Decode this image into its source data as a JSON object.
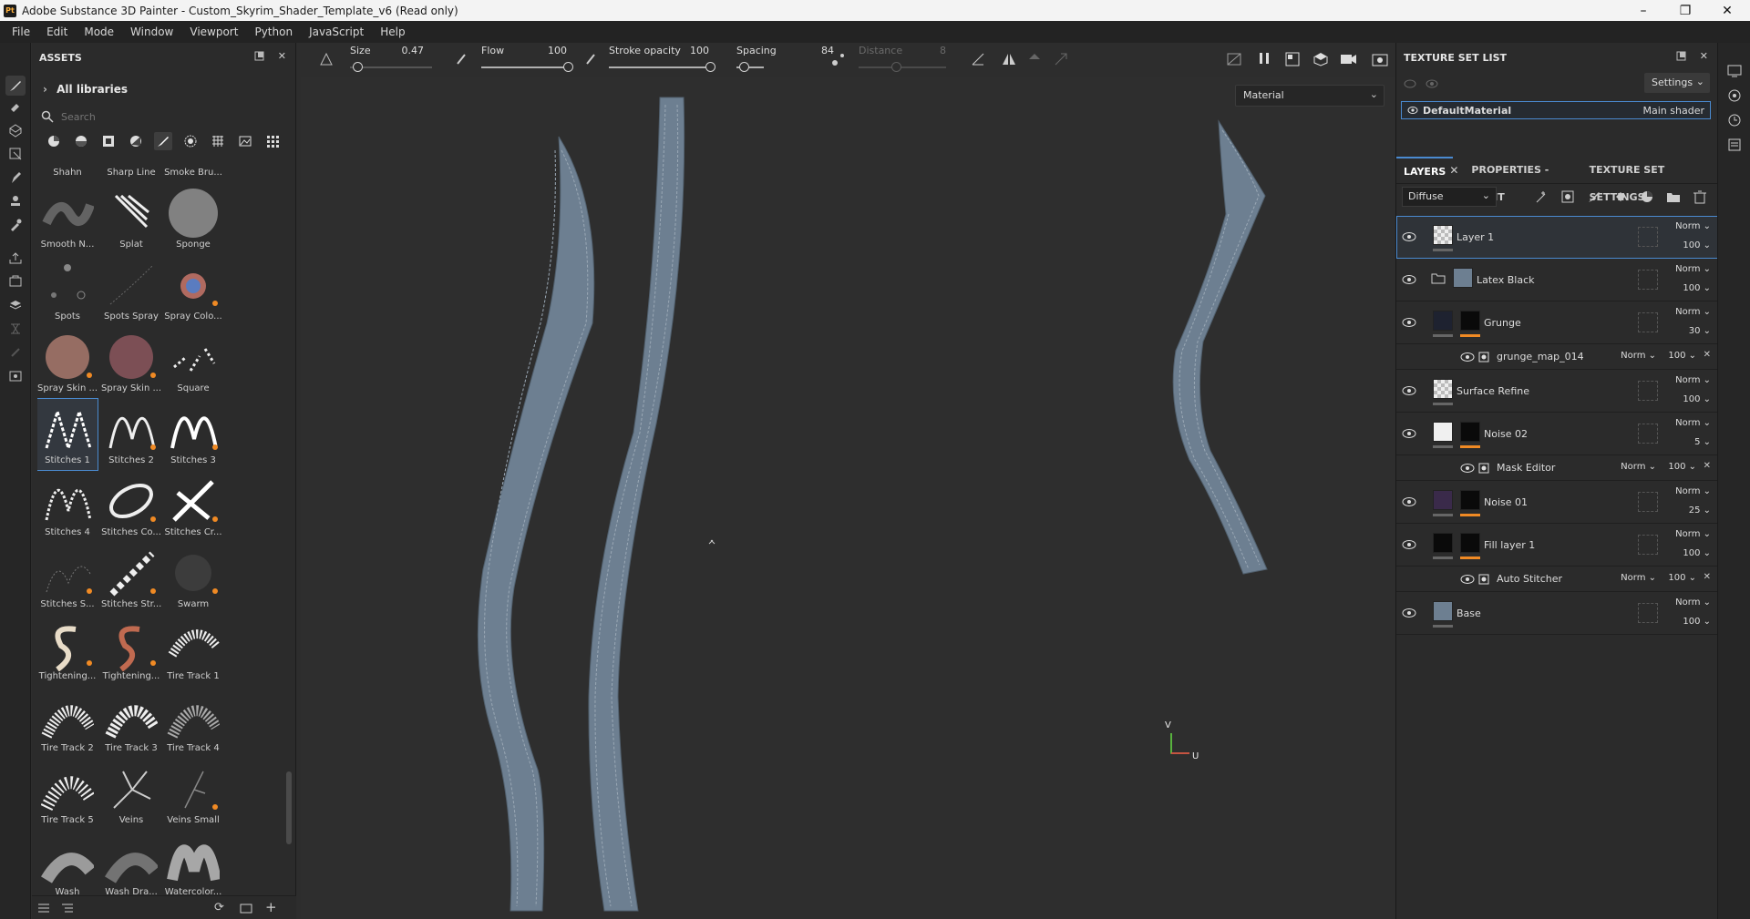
{
  "window": {
    "title": "Adobe Substance 3D Painter - Custom_Skyrim_Shader_Template_v6 (Read only)",
    "logo": "Pt",
    "controls": [
      "minimize",
      "maximize",
      "close"
    ]
  },
  "menu": [
    "File",
    "Edit",
    "Mode",
    "Window",
    "Viewport",
    "Python",
    "JavaScript",
    "Help"
  ],
  "assets": {
    "title": "ASSETS",
    "library": "All libraries",
    "search_placeholder": "Search",
    "brushes": [
      {
        "name": "Shahn"
      },
      {
        "name": "Sharp Line"
      },
      {
        "name": "Smoke Bru..."
      },
      {
        "name": "Smooth N..."
      },
      {
        "name": "Splat"
      },
      {
        "name": "Sponge"
      },
      {
        "name": "Spots"
      },
      {
        "name": "Spots Spray"
      },
      {
        "name": "Spray Colo..."
      },
      {
        "name": "Spray Skin ..."
      },
      {
        "name": "Spray Skin ..."
      },
      {
        "name": "Square"
      },
      {
        "name": "Stitches 1"
      },
      {
        "name": "Stitches 2"
      },
      {
        "name": "Stitches 3"
      },
      {
        "name": "Stitches 4"
      },
      {
        "name": "Stitches Co..."
      },
      {
        "name": "Stitches Cr..."
      },
      {
        "name": "Stitches S..."
      },
      {
        "name": "Stitches Str..."
      },
      {
        "name": "Swarm"
      },
      {
        "name": "Tightening..."
      },
      {
        "name": "Tightening..."
      },
      {
        "name": "Tire Track 1"
      },
      {
        "name": "Tire Track 2"
      },
      {
        "name": "Tire Track 3"
      },
      {
        "name": "Tire Track 4"
      },
      {
        "name": "Tire Track 5"
      },
      {
        "name": "Veins"
      },
      {
        "name": "Veins Small"
      },
      {
        "name": "Wash"
      },
      {
        "name": "Wash Dra..."
      },
      {
        "name": "Watercolor..."
      }
    ],
    "selected_brush": "Stitches 1"
  },
  "toolbar": {
    "size_label": "Size",
    "size_value": "0.47",
    "flow_label": "Flow",
    "flow_value": "100",
    "opacity_label": "Stroke opacity",
    "opacity_value": "100",
    "spacing_label": "Spacing",
    "spacing_value": "84",
    "distance_label": "Distance",
    "distance_value": "8"
  },
  "viewport": {
    "mode": "Material",
    "axis_v": "V",
    "axis_u": "U"
  },
  "texture_set": {
    "title": "TEXTURE SET LIST",
    "settings": "Settings",
    "material": "DefaultMaterial",
    "shader": "Main shader"
  },
  "tabs": [
    "LAYERS",
    "PROPERTIES - PAINT",
    "TEXTURE SET SETTINGS"
  ],
  "channel": "Diffuse",
  "layers": [
    {
      "name": "Layer 1",
      "blend": "Norm",
      "opacity": "100"
    },
    {
      "name": "Latex Black",
      "blend": "Norm",
      "opacity": "100"
    },
    {
      "name": "Grunge",
      "blend": "Norm",
      "opacity": "30"
    },
    {
      "name": "grunge_map_014",
      "blend": "Norm",
      "opacity": "100"
    },
    {
      "name": "Surface Refine",
      "blend": "Norm",
      "opacity": "100"
    },
    {
      "name": "Noise 02",
      "blend": "Norm",
      "opacity": "5"
    },
    {
      "name": "Mask Editor",
      "blend": "Norm",
      "opacity": "100"
    },
    {
      "name": "Noise 01",
      "blend": "Norm",
      "opacity": "25"
    },
    {
      "name": "Fill layer 1",
      "blend": "Norm",
      "opacity": "100"
    },
    {
      "name": "Auto Stitcher",
      "blend": "Norm",
      "opacity": "100"
    },
    {
      "name": "Base",
      "blend": "Norm",
      "opacity": "100"
    }
  ],
  "colors": {
    "accent": "#4a8ad0",
    "orange": "#f08a24",
    "strap": "#6d7f91"
  }
}
